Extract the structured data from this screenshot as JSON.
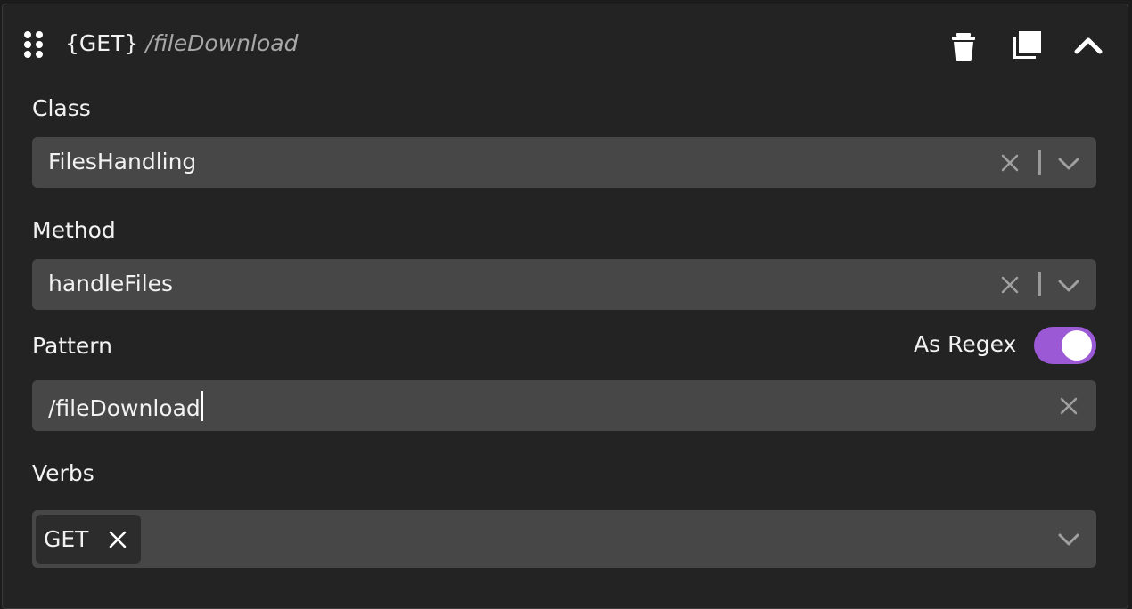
{
  "header": {
    "verb": "{GET}",
    "path": "/fileDownload",
    "icons": {
      "drag": "drag-handle-icon",
      "delete": "trash-icon",
      "duplicate": "copy-icon",
      "collapse": "chevron-up-icon"
    }
  },
  "class_field": {
    "label": "Class",
    "value": "FilesHandling"
  },
  "method_field": {
    "label": "Method",
    "value": "handleFiles"
  },
  "pattern_field": {
    "label": "Pattern",
    "value": "/fileDownload",
    "regex_label": "As Regex",
    "regex_enabled": true
  },
  "verbs_field": {
    "label": "Verbs",
    "selected": [
      "GET"
    ]
  },
  "colors": {
    "panel_bg": "#232323",
    "field_bg": "#474747",
    "chip_bg": "#2c2c2c",
    "toggle_on": "#9b59d6"
  }
}
